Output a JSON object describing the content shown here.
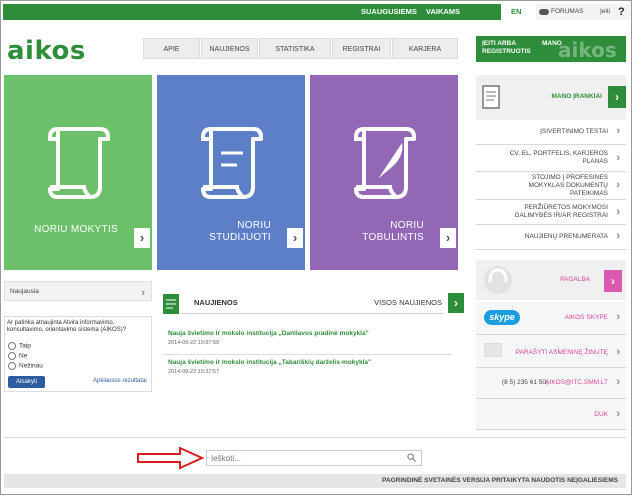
{
  "topbar": {
    "links": [
      "SUAUGUSIEMS",
      "VAIKAMS",
      "EN"
    ],
    "forumas": "FORUMAS",
    "ieiti": "Įeiti",
    "help": "?"
  },
  "brand": {
    "logo": "aikos",
    "green": "#2e8d3a"
  },
  "nav": [
    "APIE",
    "NAUJIENOS",
    "STATISTIKA",
    "REGISTRAI",
    "KARJERA"
  ],
  "login": {
    "line1": "ĮEITI ARBA",
    "line2": "REGISTRUOTIS",
    "mano": "MANO",
    "watermark": "aikos"
  },
  "tiles": [
    {
      "line1": "NORIU MOKYTIS",
      "line2": "",
      "color": "#6cc06a"
    },
    {
      "line1": "NORIU",
      "line2": "STUDIJUOTI",
      "color": "#5c7fc7"
    },
    {
      "line1": "NORIU",
      "line2": "TOBULINTIS",
      "color": "#9267b6"
    }
  ],
  "tools": {
    "title": "MANO ĮRANKIAI",
    "items": [
      [
        "ĮSIVERTINIMO TESTAI"
      ],
      [
        "CV, EL. PORTFELIS, KARJEROS",
        "PLANAS"
      ],
      [
        "STOJIMO Į PROFESINES",
        "MOKYKLAS DOKUMENTŲ",
        "PATEIKIMAS"
      ],
      [
        "PERŽIŪRĖTOS MOKYMOSI",
        "GALIMYBĖS IR/AR REGISTRAI"
      ],
      [
        "NAUJIENŲ PRENUMERATA"
      ]
    ]
  },
  "help_panel": {
    "pagalba": "PAGALBA",
    "skype_logo": "skype",
    "skype": "AIKOS SKYPE",
    "message": "PARAŠYTI ASMENINĘ ŽINUTĘ",
    "phone": "(8 5) 235 61 50",
    "email": "AIKOS@ITC.SMM.LT",
    "duk": "DUK"
  },
  "naujausia": "Naujausia",
  "poll": {
    "question": "Ar patinka atnaujinta Atvira informavimo, konsultavimo, orientavimo sistema (AIKOS)?",
    "options": [
      "Taip",
      "Ne",
      "Nežinau"
    ],
    "button": "Atsakyti",
    "results": "Apklausos rezultatai"
  },
  "news": {
    "header": "NAUJIENOS",
    "all": "VISOS NAUJIENOS",
    "items": [
      {
        "title": "Nauja švietimo ir mokslo institucija „Danilavos pradinė mokykla\"",
        "date": "2014-09-22 10:37:59"
      },
      {
        "title": "Nauja švietimo ir mokslo institucija „Tabariškių darželis-mokykla\"",
        "date": "2014-09-22 10:37:57"
      }
    ]
  },
  "search": {
    "placeholder": "Ieškoti..."
  },
  "footer": "PAGRINDINĖ SVETAINĖS VERSIJA PRITAIKYTA NAUDOTIS NEĮGALIESIEMS"
}
